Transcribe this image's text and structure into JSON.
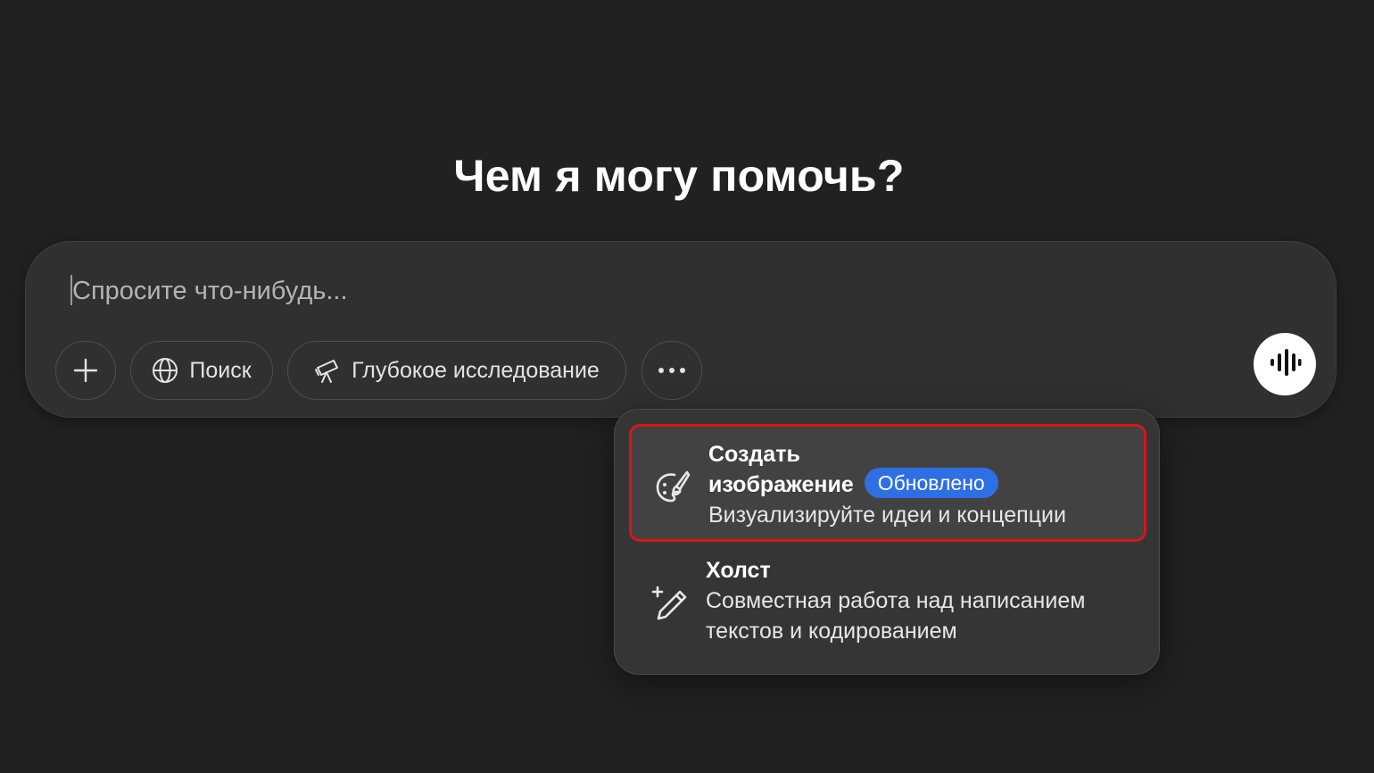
{
  "heading": "Чем я могу помочь?",
  "composer": {
    "placeholder": "Спросите что-нибудь...",
    "buttons": {
      "attach_icon": "plus-icon",
      "search_label": "Поиск",
      "search_icon": "globe-icon",
      "research_label": "Глубокое исследование",
      "research_icon": "telescope-icon",
      "more_icon": "ellipsis-icon",
      "voice_icon": "voice-waveform-icon"
    }
  },
  "menu": {
    "items": [
      {
        "title_line1": "Создать",
        "title_line2": "изображение",
        "badge": "Обновлено",
        "description": "Визуализируйте идеи и концепции",
        "icon": "paint-palette-icon",
        "highlighted": true,
        "highlight_color": "#d9141b"
      },
      {
        "title": "Холст",
        "description_line1": "Совместная работа над написанием",
        "description_line2": "текстов и кодированием",
        "icon": "pencil-sparkle-icon",
        "highlighted": false
      }
    ]
  },
  "colors": {
    "background": "#212121",
    "composer": "#303030",
    "menu": "#353535",
    "badge": "#2f6fe4",
    "voice_button": "#ffffff"
  }
}
